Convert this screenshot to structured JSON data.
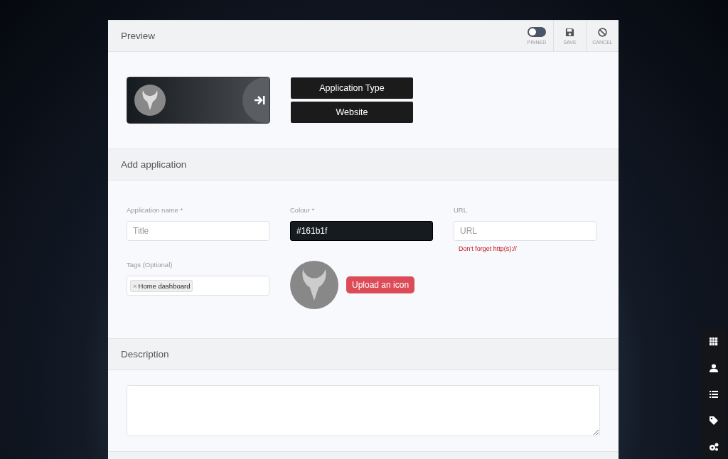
{
  "header": {
    "title": "Preview",
    "pinned": {
      "label": "PINNED",
      "on": false
    },
    "actions": [
      {
        "kind": "save",
        "label": "SAVE"
      },
      {
        "kind": "cancel",
        "label": "CANCEL"
      }
    ]
  },
  "preview": {
    "buttons": [
      "Application Type",
      "Website"
    ]
  },
  "add_section": {
    "title": "Add application"
  },
  "fields": {
    "name": {
      "label": "Application name *",
      "placeholder": "Title"
    },
    "colour": {
      "label": "Colour *",
      "value": "#161b1f"
    },
    "url": {
      "label": "URL",
      "placeholder": "URL",
      "hint": "Don't forget http(s)://"
    },
    "tags": {
      "label": "Tags (Optional)",
      "items": [
        {
          "remove": "×",
          "text": "Home dashboard"
        }
      ]
    },
    "upload": "Upload an icon"
  },
  "description": {
    "title": "Description"
  },
  "dock": [
    {
      "kind": "grid"
    },
    {
      "kind": "user"
    },
    {
      "kind": "list"
    },
    {
      "kind": "tag"
    },
    {
      "kind": "gears"
    }
  ]
}
